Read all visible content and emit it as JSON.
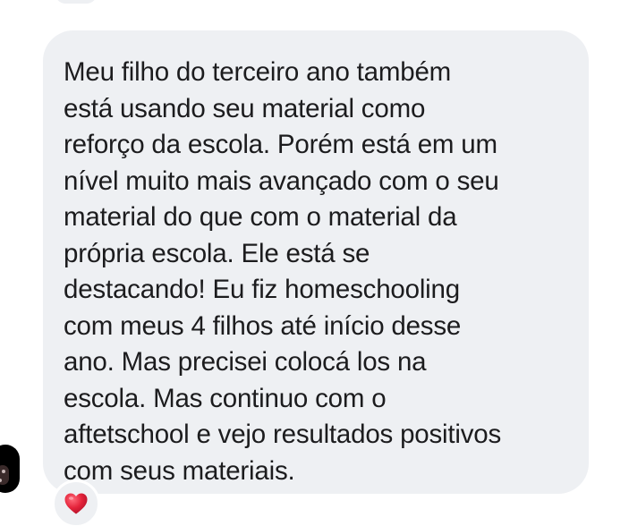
{
  "message": {
    "text": "Meu filho do terceiro ano também\nestá usando seu material como\nreforço da escola. Porém está em um\nnível muito mais avançado com o seu\nmaterial do que com o material da\nprópria escola. Ele está se\ndestacando! Eu fiz homeschooling\ncom meus 4 filhos até início desse\nano. Mas precisei colocá los na\nescola. Mas continuo com o\naftetschool e vejo resultados positivos\ncom seus materiais."
  },
  "reaction": {
    "icon": "heart-icon",
    "color": "#e4233a"
  },
  "colors": {
    "bubble": "#eef0f3",
    "text": "#1c1c1e"
  }
}
